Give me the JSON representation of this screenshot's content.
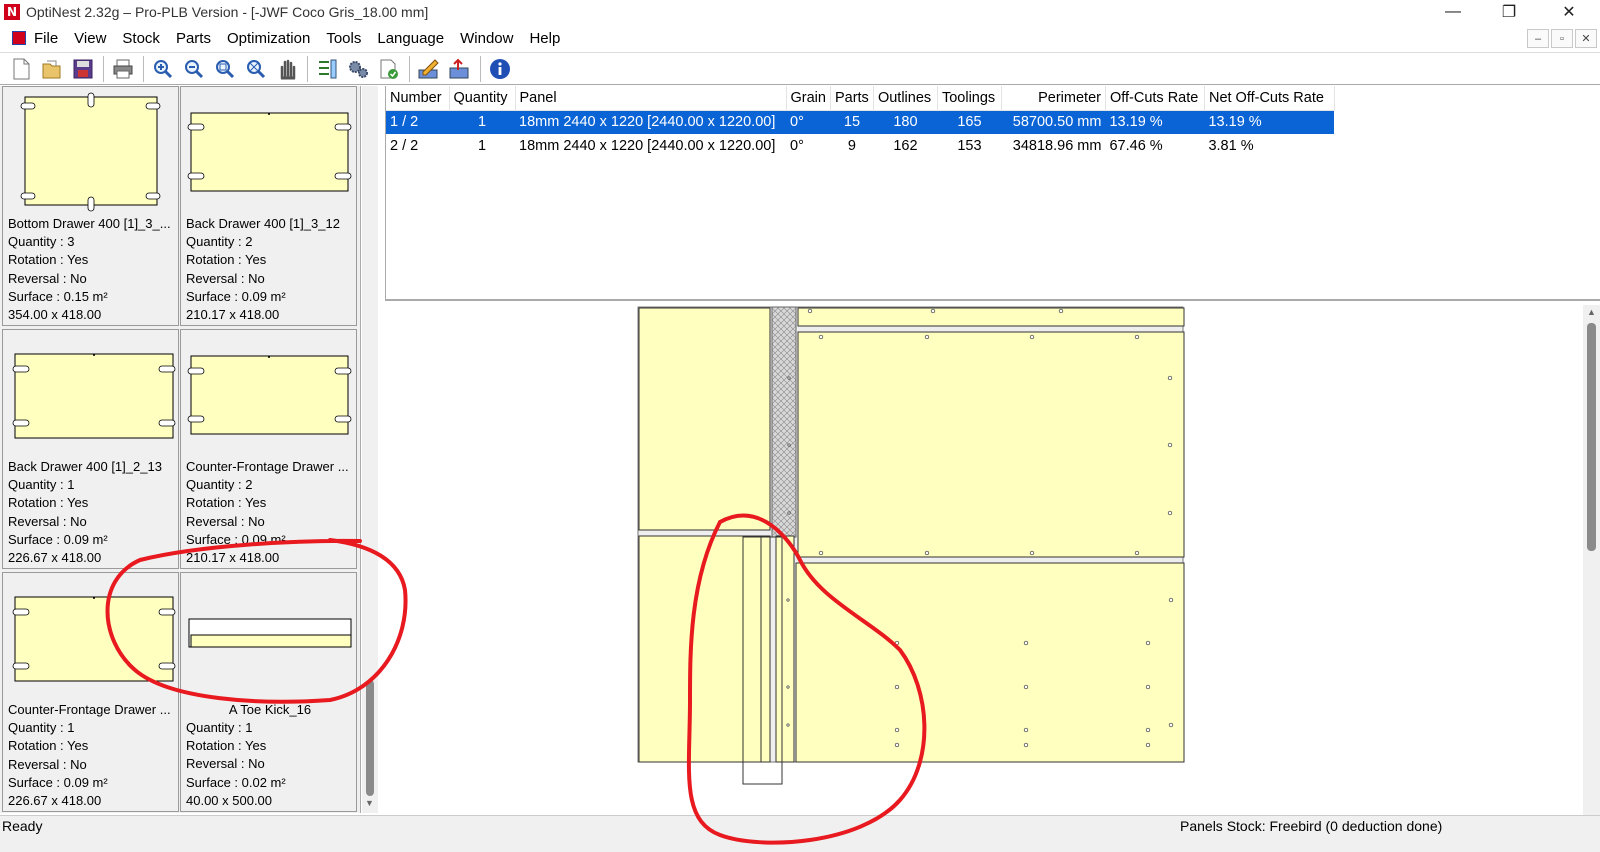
{
  "window": {
    "title": "OptiNest 2.32g – Pro-PLB Version - [-JWF Coco Gris_18.00 mm]",
    "minimize": "—",
    "maximize": "❐",
    "close": "✕"
  },
  "menu": [
    "File",
    "View",
    "Stock",
    "Parts",
    "Optimization",
    "Tools",
    "Language",
    "Window",
    "Help"
  ],
  "mdi": {
    "minimize": "–",
    "restore": "▫",
    "close": "✕"
  },
  "toolbar": [
    "new-icon",
    "open-icon",
    "save-icon",
    "print-icon",
    "zoom-in-icon",
    "zoom-out-icon",
    "zoom-window-icon",
    "zoom-all-icon",
    "pan-hand-icon",
    "parts-list-icon",
    "settings-gears-icon",
    "check-document-icon",
    "edit-pencil-icon",
    "export-icon",
    "info-icon"
  ],
  "parts": [
    {
      "name": "Bottom Drawer 400 [1]_3_...",
      "quantity": "Quantity : 3",
      "rotation": "Rotation : Yes",
      "reversal": "Reversal : No",
      "surface": "Surface : 0.15 m²",
      "size": "354.00 x 418.00"
    },
    {
      "name": "Back Drawer 400 [1]_3_12",
      "quantity": "Quantity : 2",
      "rotation": "Rotation : Yes",
      "reversal": "Reversal : No",
      "surface": "Surface : 0.09 m²",
      "size": "210.17 x 418.00"
    },
    {
      "name": "Back Drawer 400 [1]_2_13",
      "quantity": "Quantity : 1",
      "rotation": "Rotation : Yes",
      "reversal": "Reversal : No",
      "surface": "Surface : 0.09 m²",
      "size": "226.67 x 418.00"
    },
    {
      "name": "Counter-Frontage Drawer ...",
      "quantity": "Quantity : 2",
      "rotation": "Rotation : Yes",
      "reversal": "Reversal : No",
      "surface": "Surface : 0.09 m²",
      "size": "210.17 x 418.00"
    },
    {
      "name": "Counter-Frontage Drawer ...",
      "quantity": "Quantity : 1",
      "rotation": "Rotation : Yes",
      "reversal": "Reversal : No",
      "surface": "Surface : 0.09 m²",
      "size": "226.67 x 418.00"
    },
    {
      "name": "A Toe Kick_16",
      "quantity": "Quantity : 1",
      "rotation": "Rotation : Yes",
      "reversal": "Reversal : No",
      "surface": "Surface : 0.02 m²",
      "size": "40.00 x 500.00"
    }
  ],
  "table": {
    "headers": [
      "Number",
      "Quantity",
      "Panel",
      "Grain",
      "Parts",
      "Outlines",
      "Toolings",
      "Perimeter",
      "Off-Cuts Rate",
      "Net Off-Cuts Rate"
    ],
    "rows": [
      [
        "1 / 2",
        "1",
        "18mm 2440 x 1220 [2440.00 x 1220.00]",
        "0°",
        "15",
        "180",
        "165",
        "58700.50 mm",
        "13.19 %",
        "13.19 %"
      ],
      [
        "2 / 2",
        "1",
        "18mm 2440 x 1220 [2440.00 x 1220.00]",
        "0°",
        "9",
        "162",
        "153",
        "34818.96 mm",
        "67.46 %",
        "3.81 %"
      ]
    ]
  },
  "status": {
    "left": "Ready",
    "right": "Panels Stock: Freebird (0 deduction done)"
  },
  "colors": {
    "panel": "#ffffc0",
    "selection": "#0a64d6",
    "annotation": "#e8191f"
  }
}
